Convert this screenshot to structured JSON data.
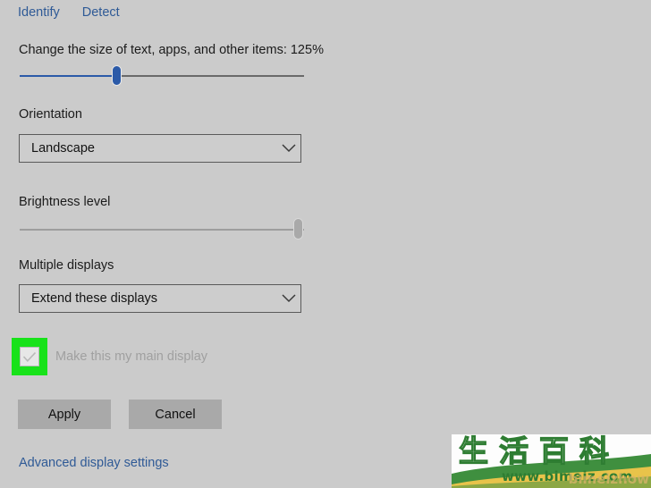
{
  "window": {
    "background_color": "#cbcbcb",
    "link_color": "#2f5a96",
    "highlight_color": "#18e21a"
  },
  "top_links": {
    "identify": "Identify",
    "detect": "Detect"
  },
  "scaling": {
    "label": "Change the size of text, apps, and other items: 125%",
    "value_percent": "125%",
    "slider_position_percent": 34,
    "slider_enabled": true
  },
  "orientation": {
    "label": "Orientation",
    "selected": "Landscape",
    "chevron": "chevron-down-icon"
  },
  "brightness": {
    "label": "Brightness level",
    "slider_position_percent": 100,
    "slider_enabled": false
  },
  "multiple_displays": {
    "label": "Multiple displays",
    "selected": "Extend these displays",
    "chevron": "chevron-down-icon"
  },
  "main_display_checkbox": {
    "label": "Make this my main display",
    "checked": true,
    "enabled": false,
    "check_icon": "checkmark-icon",
    "highlighted": true
  },
  "buttons": {
    "apply": "Apply",
    "cancel": "Cancel"
  },
  "advanced_link": {
    "label": "Advanced display settings"
  },
  "watermark": {
    "characters": [
      "生",
      "活",
      "百",
      "科"
    ],
    "url": "www.bimeiz.com",
    "ghost_text": "bimeizhow",
    "green": "#2e7d32",
    "yellow": "#e8c34a"
  }
}
